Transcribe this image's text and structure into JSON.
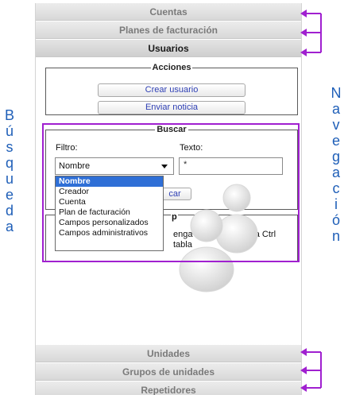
{
  "accordion": {
    "cuentas": "Cuentas",
    "planes": "Planes de facturación",
    "usuarios": "Usuarios",
    "unidades": "Unidades",
    "grupos": "Grupos de unidades",
    "repetidores": "Repetidores"
  },
  "acciones": {
    "legend": "Acciones",
    "crear_usuario": "Crear usuario",
    "enviar_noticia": "Enviar noticia"
  },
  "buscar": {
    "legend": "Buscar",
    "filtro_label": "Filtro:",
    "texto_label": "Texto:",
    "filtro_selected": "Nombre",
    "texto_value": "*",
    "buscar_button_visible": "car",
    "dropdown_options": [
      "Nombre",
      "Creador",
      "Cuenta",
      "Plan de facturación",
      "Campos personalizados",
      "Campos administrativos"
    ]
  },
  "ayuda": {
    "legend_visible": "p",
    "line1_visible": "enga apretada la tecla Ctrl",
    "line2_visible": "tabla"
  },
  "annotations": {
    "busqueda_letters": [
      "B",
      "ú",
      "s",
      "q",
      "u",
      "e",
      "d",
      "a"
    ],
    "navegacion_letters": [
      "N",
      "a",
      "v",
      "e",
      "g",
      "a",
      "c",
      "i",
      "ó",
      "n"
    ],
    "highlight_color": "#a020d0",
    "letter_color": "#1f5fb8"
  }
}
